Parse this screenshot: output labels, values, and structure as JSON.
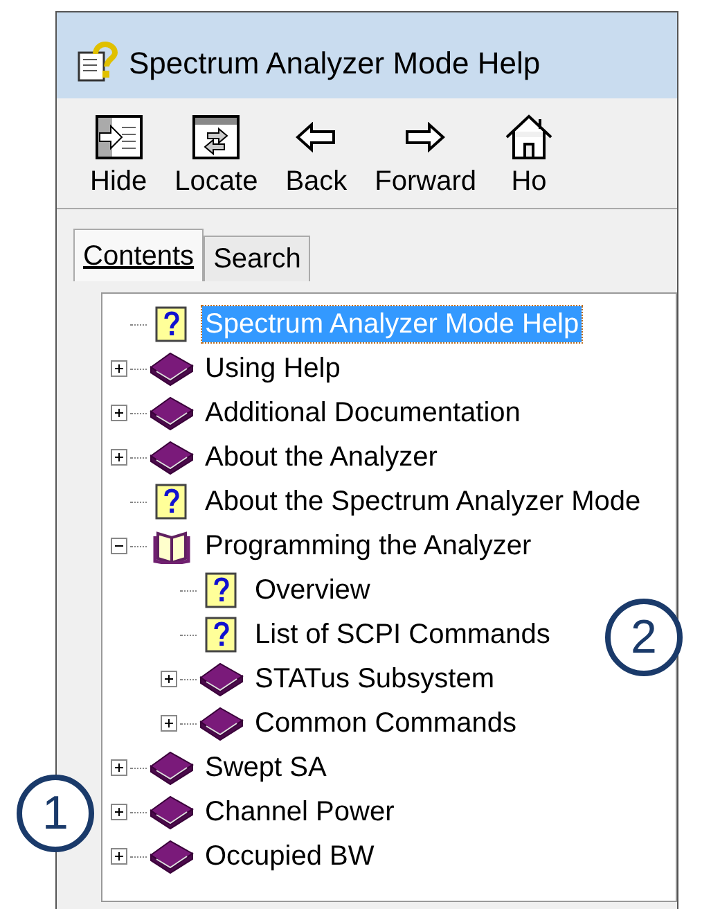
{
  "window": {
    "title": "Spectrum Analyzer Mode Help"
  },
  "toolbar": [
    {
      "label": "Hide",
      "kind": "hide"
    },
    {
      "label": "Locate",
      "kind": "locate"
    },
    {
      "label": "Back",
      "kind": "back"
    },
    {
      "label": "Forward",
      "kind": "forward"
    },
    {
      "label": "Ho",
      "kind": "home"
    }
  ],
  "tabs": [
    {
      "label": "Contents",
      "selected": true
    },
    {
      "label": "Search",
      "selected": false
    }
  ],
  "tree": [
    {
      "label": "Spectrum Analyzer Mode Help",
      "kind": "page",
      "selected": true
    },
    {
      "label": "Using Help",
      "kind": "book",
      "expanded": false,
      "selected": false
    },
    {
      "label": "Additional Documentation",
      "kind": "book",
      "expanded": false,
      "selected": false
    },
    {
      "label": "About the Analyzer",
      "kind": "book",
      "expanded": false,
      "selected": false
    },
    {
      "label": "About the Spectrum Analyzer Mode",
      "kind": "page",
      "selected": false
    },
    {
      "label": "Programming the Analyzer",
      "kind": "book",
      "expanded": true,
      "selected": false,
      "children": [
        {
          "label": "Overview",
          "kind": "page",
          "selected": false
        },
        {
          "label": "List of SCPI Commands",
          "kind": "page",
          "selected": false
        },
        {
          "label": "STATus Subsystem",
          "kind": "book",
          "expanded": false,
          "selected": false
        },
        {
          "label": "Common Commands",
          "kind": "book",
          "expanded": false,
          "selected": false
        }
      ]
    },
    {
      "label": "Swept SA",
      "kind": "book",
      "expanded": false,
      "selected": false
    },
    {
      "label": "Channel Power",
      "kind": "book",
      "expanded": false,
      "selected": false
    },
    {
      "label": "Occupied BW",
      "kind": "book",
      "expanded": false,
      "selected": false
    }
  ],
  "callouts": [
    {
      "label": "1"
    },
    {
      "label": "2"
    }
  ]
}
